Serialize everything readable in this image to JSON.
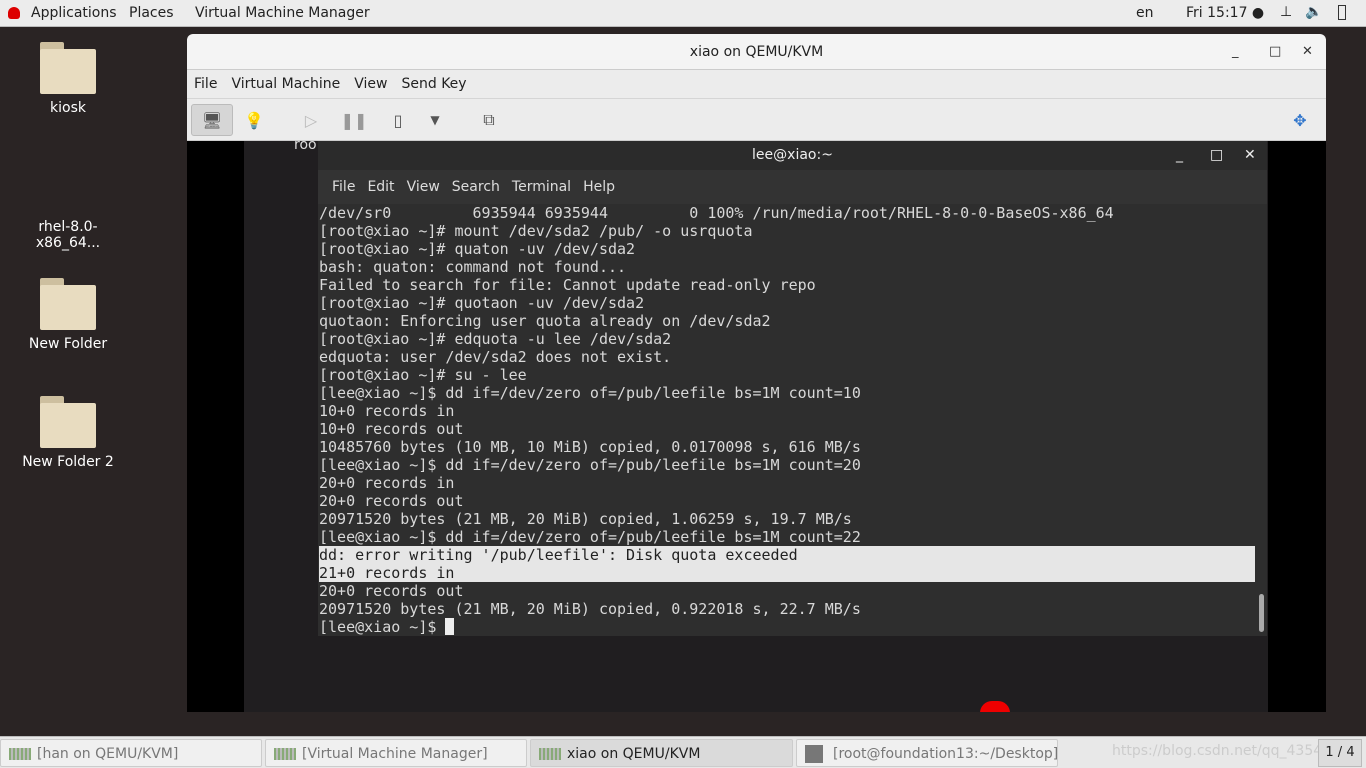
{
  "topbar": {
    "apps": "Applications",
    "places": "Places",
    "vmm": "Virtual Machine Manager",
    "lang": "en",
    "clock": "Fri 15:17 ●"
  },
  "desktop": [
    {
      "label": "kiosk"
    },
    {
      "label": "rhel-8.0-x86_64..."
    },
    {
      "label": "New Folder"
    },
    {
      "label": "New Folder 2"
    }
  ],
  "vm": {
    "title": "xiao on QEMU/KVM",
    "menu": [
      "File",
      "Virtual Machine",
      "View",
      "Send Key"
    ],
    "guest_label": "roo"
  },
  "terminal": {
    "title": "lee@xiao:~",
    "menu": [
      "File",
      "Edit",
      "View",
      "Search",
      "Terminal",
      "Help"
    ],
    "lines": [
      "/dev/sr0         6935944 6935944         0 100% /run/media/root/RHEL-8-0-0-BaseOS-x86_64",
      "[root@xiao ~]# mount /dev/sda2 /pub/ -o usrquota",
      "[root@xiao ~]# quaton -uv /dev/sda2",
      "bash: quaton: command not found...",
      "Failed to search for file: Cannot update read-only repo",
      "[root@xiao ~]# quotaon -uv /dev/sda2",
      "quotaon: Enforcing user quota already on /dev/sda2",
      "[root@xiao ~]# edquota -u lee /dev/sda2",
      "edquota: user /dev/sda2 does not exist.",
      "[root@xiao ~]# su - lee",
      "[lee@xiao ~]$ dd if=/dev/zero of=/pub/leefile bs=1M count=10",
      "10+0 records in",
      "10+0 records out",
      "10485760 bytes (10 MB, 10 MiB) copied, 0.0170098 s, 616 MB/s",
      "[lee@xiao ~]$ dd if=/dev/zero of=/pub/leefile bs=1M count=20",
      "20+0 records in",
      "20+0 records out",
      "20971520 bytes (21 MB, 20 MiB) copied, 1.06259 s, 19.7 MB/s",
      "[lee@xiao ~]$ dd if=/dev/zero of=/pub/leefile bs=1M count=22",
      "dd: error writing '/pub/leefile': Disk quota exceeded",
      "21+0 records in",
      "20+0 records out",
      "20971520 bytes (21 MB, 20 MiB) copied, 0.922018 s, 22.7 MB/s"
    ],
    "prompt": "[lee@xiao ~]$ "
  },
  "taskbar": {
    "tasks": [
      "[han on QEMU/KVM]",
      "[Virtual Machine Manager]",
      "xiao on QEMU/KVM",
      "[root@foundation13:~/Desktop]"
    ],
    "workspace": "1 / 4",
    "watermark": "https://blog.csdn.net/qq_4354"
  }
}
